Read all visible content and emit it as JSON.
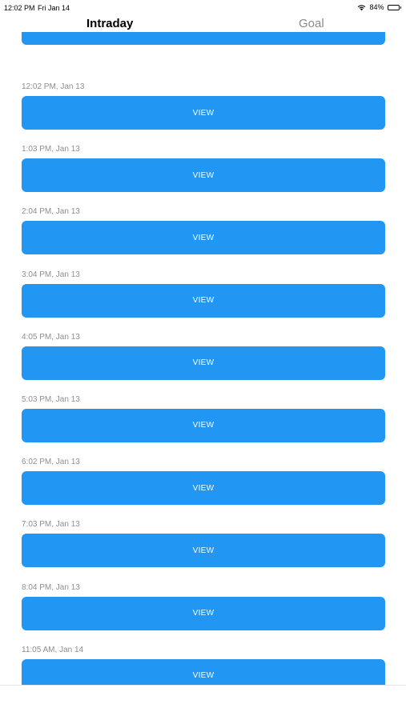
{
  "status_bar": {
    "time": "12:02 PM",
    "date": "Fri Jan 14",
    "battery": "84%",
    "battery_level": 0.84
  },
  "tabs": [
    {
      "label": "Intraday",
      "active": true
    },
    {
      "label": "Goal",
      "active": false
    }
  ],
  "colors": {
    "button": "#2196f3",
    "active_tab": "#000000",
    "inactive_tab": "#8a8a8a",
    "timestamp": "#8e8e93"
  },
  "entries": [
    {
      "time": "",
      "button_label": "VIEW"
    },
    {
      "time": "12:02 PM, Jan 13",
      "button_label": "VIEW"
    },
    {
      "time": "1:03 PM, Jan 13",
      "button_label": "VIEW"
    },
    {
      "time": "2:04 PM, Jan 13",
      "button_label": "VIEW"
    },
    {
      "time": "3:04 PM, Jan 13",
      "button_label": "VIEW"
    },
    {
      "time": "4:05 PM, Jan 13",
      "button_label": "VIEW"
    },
    {
      "time": "5:03 PM, Jan 13",
      "button_label": "VIEW"
    },
    {
      "time": "6:02 PM, Jan 13",
      "button_label": "VIEW"
    },
    {
      "time": "7:03 PM, Jan 13",
      "button_label": "VIEW"
    },
    {
      "time": "8:04 PM, Jan 13",
      "button_label": "VIEW"
    },
    {
      "time": "11:05 AM, Jan 14",
      "button_label": "VIEW"
    }
  ]
}
